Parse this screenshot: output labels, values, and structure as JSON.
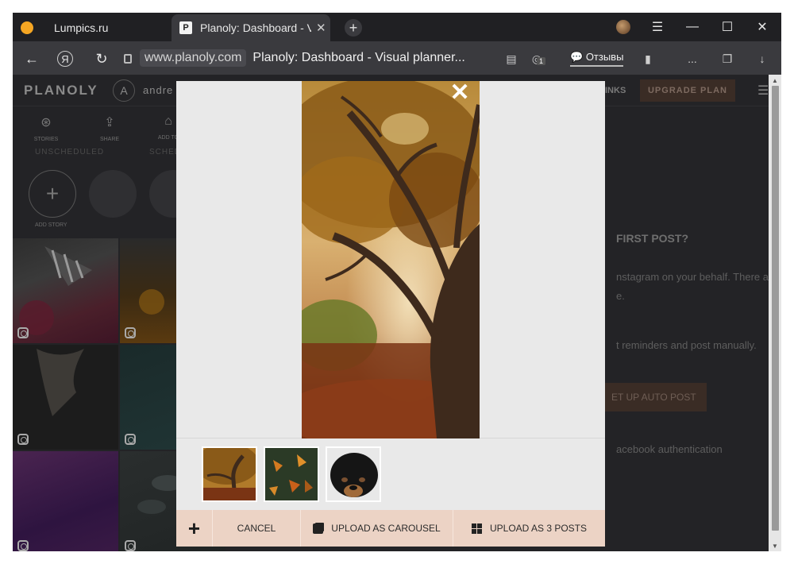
{
  "browser": {
    "tabs": [
      {
        "title": "Lumpics.ru",
        "active": false
      },
      {
        "title": "Planoly: Dashboard - Vis",
        "active": true
      }
    ],
    "address": {
      "domain": "www.planoly.com",
      "page_title": "Planoly: Dashboard - Visual planner..."
    },
    "reviews_label": "Отзывы",
    "extension_badge": "1",
    "more_label": "..."
  },
  "app": {
    "logo": "PLANOLY",
    "avatar_letter": "A",
    "username": "andre",
    "links_fragment": "INKS",
    "upgrade_label": "UPGRADE PLAN",
    "tools": [
      {
        "label": "STORIES",
        "icon": "stories-icon"
      },
      {
        "label": "SHARE",
        "icon": "share-icon"
      },
      {
        "label": "ADD TO",
        "icon": "add-icon"
      }
    ],
    "unscheduled_label": "UNSCHEDULED",
    "scheduled_label": "SCHEDI",
    "add_story_label": "ADD STORY",
    "right_panel": {
      "heading": "FIRST POST?",
      "line1": "nstagram on your behalf. There ar",
      "line2": "e.",
      "line3": "t reminders and post manually.",
      "auto_post_label": "ET UP AUTO POST",
      "fb_line": "acebook authentication"
    }
  },
  "modal": {
    "thumbnails": [
      {
        "name": "autumn-tree"
      },
      {
        "name": "autumn-leaves"
      },
      {
        "name": "black-puppy"
      }
    ],
    "actions": {
      "cancel": "CANCEL",
      "carousel": "UPLOAD AS CAROUSEL",
      "posts": "UPLOAD AS 3 POSTS"
    }
  }
}
